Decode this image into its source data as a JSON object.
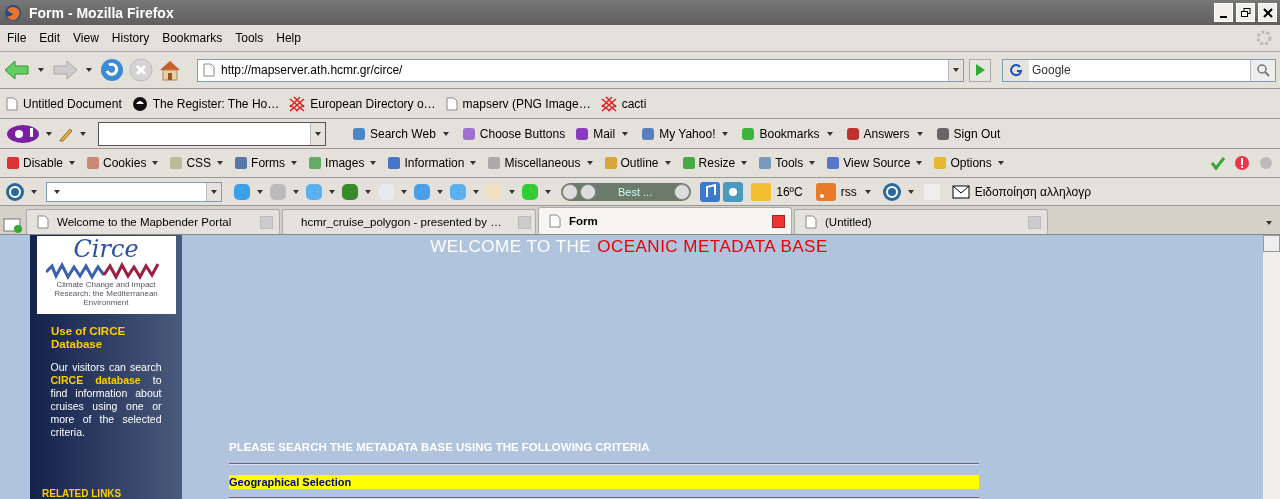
{
  "window": {
    "title": "Form - Mozilla Firefox"
  },
  "menu": [
    "File",
    "Edit",
    "View",
    "History",
    "Bookmarks",
    "Tools",
    "Help"
  ],
  "address_bar": {
    "url": "http://mapserver.ath.hcmr.gr/circe/"
  },
  "search": {
    "placeholder": "Google"
  },
  "bookmarks": [
    "Untitled Document",
    "The Register: The Ho…",
    "European Directory o…",
    "mapserv (PNG Image…",
    "cacti"
  ],
  "yahoo_toolbar": [
    {
      "label": "Search Web",
      "dropdown": true
    },
    {
      "label": "Choose Buttons",
      "dropdown": false
    },
    {
      "label": "Mail",
      "dropdown": true
    },
    {
      "label": "My Yahoo!",
      "dropdown": true
    },
    {
      "label": "Bookmarks",
      "dropdown": true
    },
    {
      "label": "Answers",
      "dropdown": true
    },
    {
      "label": "Sign Out",
      "dropdown": false
    }
  ],
  "developer_toolbar": [
    "Disable",
    "Cookies",
    "CSS",
    "Forms",
    "Images",
    "Information",
    "Miscellaneous",
    "Outline",
    "Resize",
    "Tools",
    "View Source",
    "Options"
  ],
  "addon_toolbar": {
    "media_title": "Best ...",
    "temperature": "16ºC",
    "feed": "rss",
    "notice": "Ειδοποίηση αλληλογρ"
  },
  "tabs": [
    {
      "label": "Welcome to the Mapbender Portal",
      "selected": false
    },
    {
      "label": "hcmr_cruise_polygon - presented by …",
      "selected": false
    },
    {
      "label": "Form",
      "selected": true
    },
    {
      "label": "(Untitled)",
      "selected": false
    }
  ],
  "page": {
    "logo": {
      "wordmark": "Circe",
      "caption": "Climate Change and Impact Research: the Mediterranean Environment"
    },
    "sidebar": {
      "title": "Use of CIRCE Database",
      "text": "Our visitors can search **CIRCE database** to find information about cruises using one or more of the selected criteria.",
      "links_heading": "RELATED LINKS"
    },
    "heading": {
      "lead": "WELCOME TO THE",
      "highlight": "OCEANIC METADATA BASE"
    },
    "instructions": "PLEASE SEARCH THE METADATA BASE USING THE FOLLOWING CRITERIA",
    "section": "Geographical Selection"
  }
}
